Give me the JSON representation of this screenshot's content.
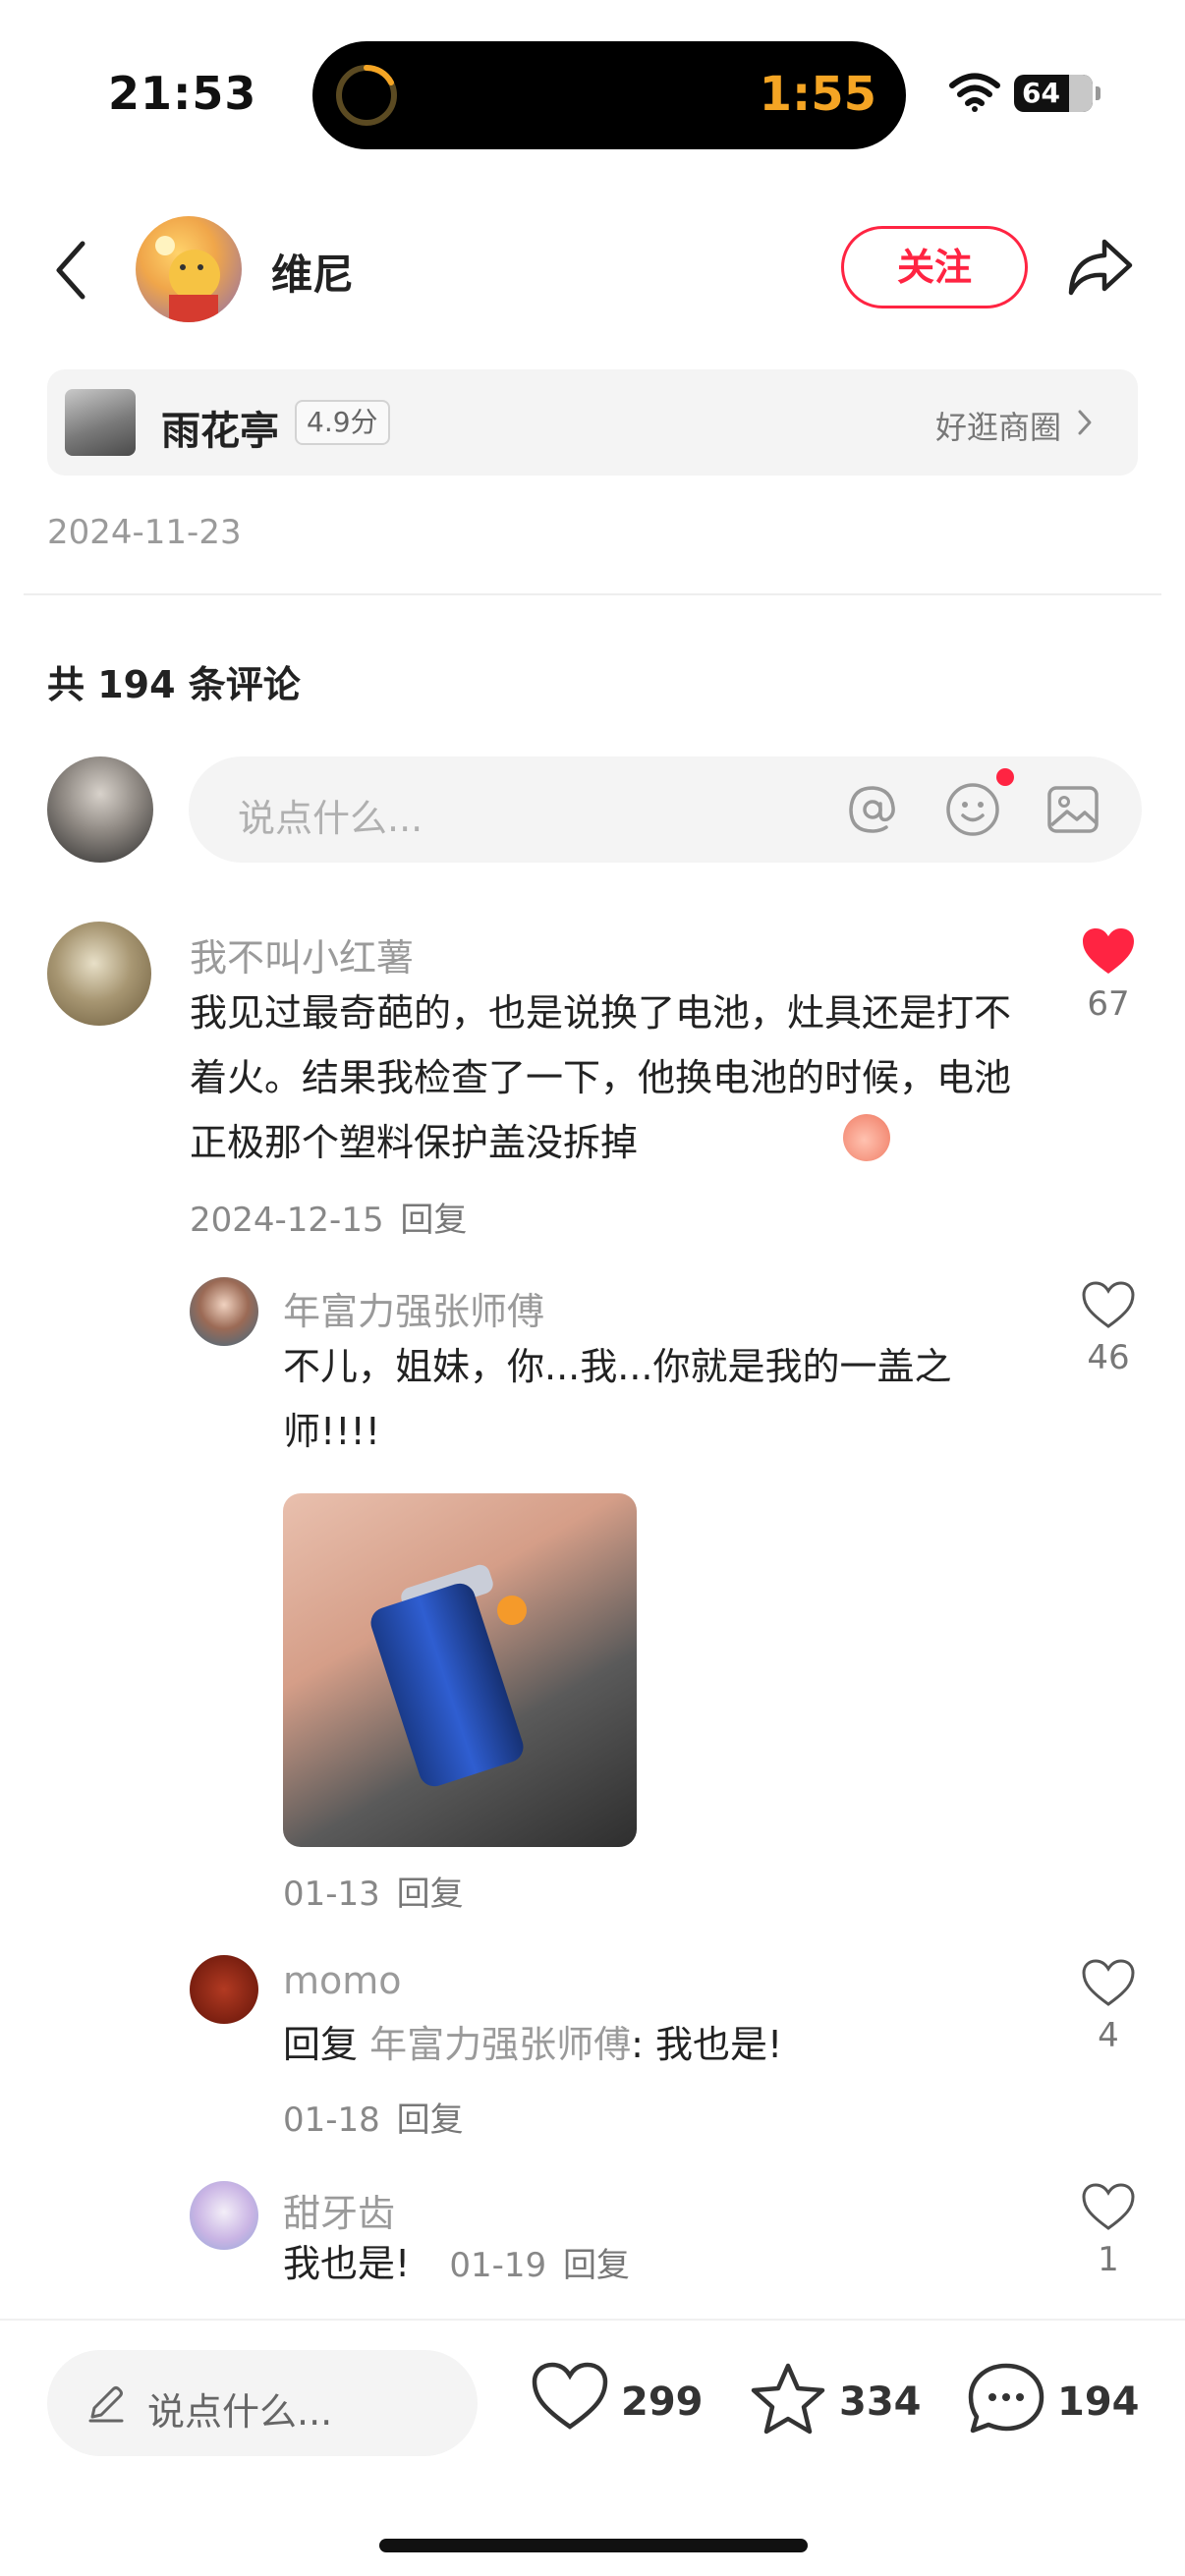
{
  "status_bar": {
    "time": "21:53",
    "timer": "1:55",
    "battery": "64"
  },
  "header": {
    "author_name": "维尼",
    "follow_label": "关注"
  },
  "location": {
    "name": "雨花亭",
    "score": "4.9分",
    "circle_label": "好逛商圈"
  },
  "post_date": "2024-11-23",
  "comments_header": "共 194 条评论",
  "comment_input": {
    "placeholder": "说点什么..."
  },
  "comments": [
    {
      "user": "我不叫小红薯",
      "text": "我见过最奇葩的，也是说换了电池，灶具还是打不着火。结果我检查了一下，他换电池的时候，电池正极那个塑料保护盖没拆掉",
      "date": "2024-12-15",
      "reply_label": "回复",
      "likes": "67",
      "liked": true
    },
    {
      "user": "年富力强张师傅",
      "text": "不儿，姐妹，你...我...你就是我的一盖之师!!!!",
      "date": "01-13",
      "reply_label": "回复",
      "likes": "46",
      "liked": false
    },
    {
      "user": "momo",
      "reply_prefix": "回复",
      "reply_to": "年富力强张师傅",
      "text": ": 我也是!",
      "date": "01-18",
      "reply_label": "回复",
      "likes": "4",
      "liked": false
    },
    {
      "user": "甜牙齿",
      "text": "我也是!",
      "date": "01-19",
      "reply_label": "回复",
      "likes": "1",
      "liked": false
    }
  ],
  "bottom_bar": {
    "placeholder": "说点什么...",
    "likes": "299",
    "stars": "334",
    "comments": "194"
  },
  "colors": {
    "accent": "#ff2442",
    "muted_text": "#9a9a9a",
    "timer": "#f5a524"
  }
}
